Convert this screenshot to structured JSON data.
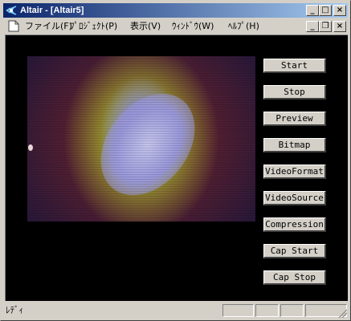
{
  "window": {
    "title": "Altair - [Altair5]",
    "controls": {
      "minimize": "_",
      "maximize": "□",
      "close": "×"
    }
  },
  "menu": {
    "items": [
      "ファイル(F)",
      "ﾌﾟﾛｼﾞｪｸﾄ(P)",
      "表示(V)",
      "ｳｨﾝﾄﾞｳ(W)",
      "ﾍﾙﾌﾟ(H)"
    ],
    "mdi_controls": {
      "minimize": "_",
      "restore": "❐",
      "close": "×"
    }
  },
  "buttons": [
    "Start",
    "Stop",
    "Preview",
    "Bitmap",
    "VideoFormat",
    "VideoSource",
    "Compression",
    "Cap Start",
    "Cap Stop"
  ],
  "status": {
    "text": "ﾚﾃﾞｨ"
  },
  "colors": {
    "title_start": "#0a246a",
    "title_end": "#a6caf0",
    "face": "#d4d0c8"
  }
}
